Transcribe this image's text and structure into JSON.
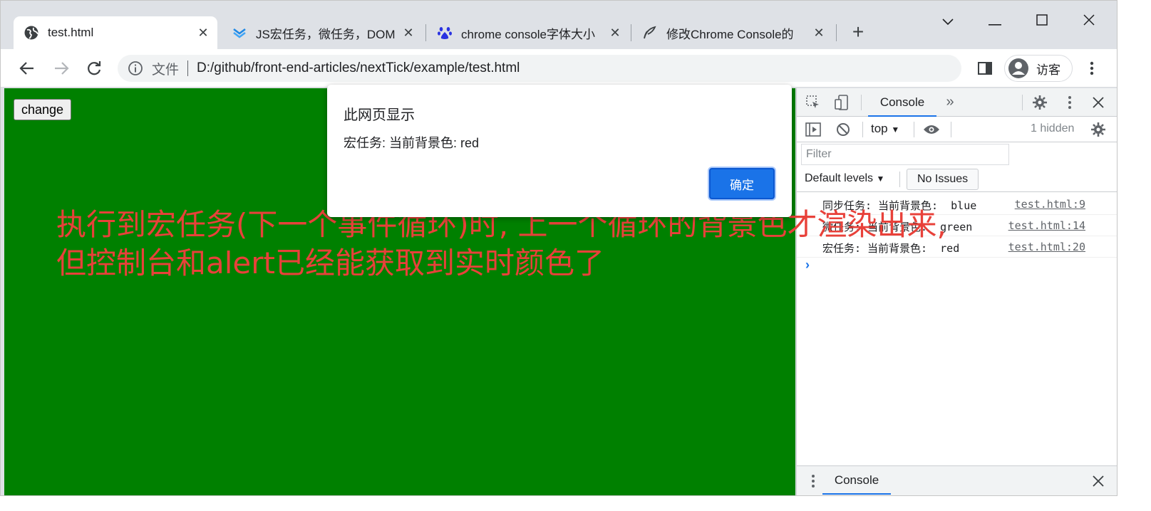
{
  "tabs": [
    {
      "title": "test.html",
      "active": true,
      "favicon": "globe-icon"
    },
    {
      "title": "JS宏任务，微任务，DOM",
      "active": false,
      "favicon": "layers-icon"
    },
    {
      "title": "chrome console字体大小",
      "active": false,
      "favicon": "baidu-paw-icon"
    },
    {
      "title": "修改Chrome Console的",
      "active": false,
      "favicon": "feather-icon"
    }
  ],
  "toolbar": {
    "scheme_label": "文件",
    "url": "D:/github/front-end-articles/nextTick/example/test.html",
    "profile_name": "访客"
  },
  "page": {
    "change_button": "change",
    "background_color": "#008000",
    "annotation_line1": "执行到宏任务(下一个事件循环)时, 上一个循环的背景色才渲染出来,",
    "annotation_line2": "但控制台和alert已经能获取到实时颜色了"
  },
  "dialog": {
    "title": "此网页显示",
    "message": "宏任务: 当前背景色: red",
    "ok_label": "确定"
  },
  "devtools": {
    "console_tab": "Console",
    "context": "top",
    "hidden_count": "1 hidden",
    "filter_placeholder": "Filter",
    "levels": "Default levels",
    "issues": "No Issues",
    "logs": [
      {
        "message": "同步任务: 当前背景色:  blue",
        "source": "test.html:9"
      },
      {
        "message": "微任务: 当前背景色:  green",
        "source": "test.html:14"
      },
      {
        "message": "宏任务: 当前背景色:  red",
        "source": "test.html:20"
      }
    ],
    "drawer_tab": "Console"
  }
}
